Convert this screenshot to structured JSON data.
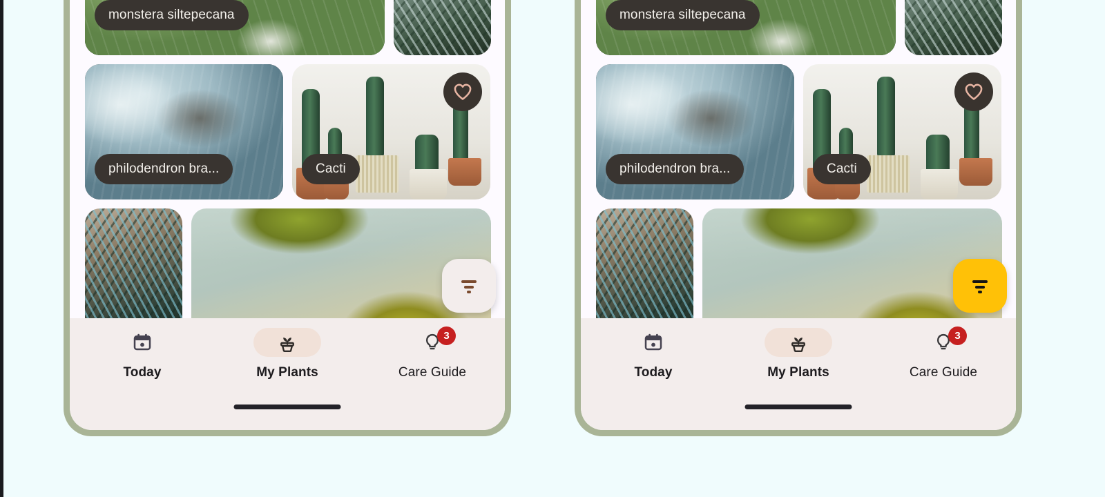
{
  "canvas": {
    "background_color": "#F0FCFD",
    "edge_strip_color": "#1B1B1F"
  },
  "theme": {
    "frame_color": "#A9B496",
    "screen_background": "#FDFAFF",
    "nav_background": "#F3EDEC",
    "caption_pill_color": "#393430",
    "caption_text_color": "#F4F1EC",
    "active_pill_color": "#F1E1D8",
    "badge_color": "#C62020",
    "heart_circle_color": "#39332E",
    "heart_outline_color": "#E8B5A3",
    "fab_default_color": "#F3EDEC",
    "fab_default_icon_color": "#7A4A2E",
    "fab_accent_color": "#FFC107",
    "fab_accent_icon_color": "#141414",
    "home_indicator_color": "#232228"
  },
  "cards": {
    "row1": [
      {
        "label": "monstera siltepecana",
        "photo": "monstera-leaves",
        "has_caption": true
      },
      {
        "label": "",
        "photo": "palm-fronds",
        "has_caption": false
      }
    ],
    "row2": [
      {
        "label": "philodendron bra...",
        "photo": "philodendron-soil",
        "has_caption": true,
        "favorite": false
      },
      {
        "label": "Cacti",
        "photo": "cacti-pots",
        "has_caption": true,
        "favorite": true
      }
    ],
    "row3": [
      {
        "label": "",
        "photo": "blue-palm",
        "has_caption": false
      },
      {
        "label": "",
        "photo": "yellow-frond",
        "has_caption": false
      }
    ]
  },
  "fab": {
    "icon": "filter-icon",
    "variant_left": "default",
    "variant_right": "accent"
  },
  "favorite_button": {
    "icon": "heart-outline-icon"
  },
  "nav": {
    "items": [
      {
        "label": "Today",
        "icon": "calendar-icon",
        "active": false,
        "badge": ""
      },
      {
        "label": "My Plants",
        "icon": "potted-plant-icon",
        "active": true,
        "badge": ""
      },
      {
        "label": "Care Guide",
        "icon": "lightbulb-icon",
        "active": false,
        "badge": "3"
      }
    ]
  },
  "devices": [
    {
      "name": "phone-preview-default"
    },
    {
      "name": "phone-preview-accent"
    }
  ]
}
